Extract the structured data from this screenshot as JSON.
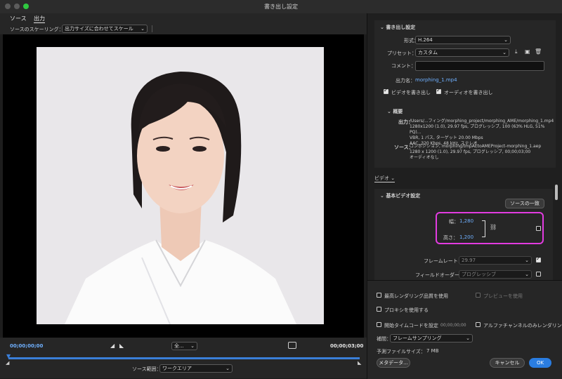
{
  "window": {
    "title": "書き出し設定"
  },
  "tabs": [
    {
      "label": "ソース"
    },
    {
      "label": "出力"
    }
  ],
  "scaling": {
    "label": "ソースのスケーリング：",
    "value": "出力サイズに合わせてスケール"
  },
  "timeline": {
    "start_timecode": "00;00;00;00",
    "end_timecode": "00;00;03;00",
    "zoom_value": "全...",
    "source_range_label": "ソース範囲：",
    "source_range_value": "ワークエリア"
  },
  "export_settings": {
    "header": "書き出し設定",
    "format_label": "形式：",
    "format_value": "H.264",
    "preset_label": "プリセット：",
    "preset_value": "カスタム",
    "comment_label": "コメント：",
    "comment_value": "",
    "output_name_label": "出力名：",
    "output_name_value": "morphing_1.mp4",
    "export_video_label": "ビデオを書き出し",
    "export_audio_label": "オーディオを書き出し",
    "export_video_checked": true,
    "export_audio_checked": true
  },
  "summary": {
    "header": "概要",
    "output_label": "出力：",
    "output_lines": [
      "/Users/...フィング/morphing_project/morphing_AME/morphing_1.mp4",
      "1280x1200 (1.0), 29.97 fps, プログレッシブ, 100 (63% HLG, 51% PQ)...",
      "VBR, 1 パス, ターゲット 20.00 Mbps",
      "AAC, 320 Kbps, 48 kHz, ステレオ"
    ],
    "source_label": "ソース：",
    "source_lines": [
      "コンポジション, morphing/tmpAEtoAMEProject-morphing_1.aep",
      "1280 x 1200 (1.0), 29.97 fps, プログレッシブ, 00;00;03;00",
      "オーディオなし"
    ]
  },
  "video_tab": {
    "label": "ビデオ"
  },
  "basic_video": {
    "header": "基本ビデオ設定",
    "match_source_button": "ソースの一致",
    "width_label": "幅：",
    "width_value": "1,280",
    "height_label": "高さ：",
    "height_value": "1,200",
    "frame_rate_label": "フレームレート：",
    "frame_rate_value": "29.97",
    "field_order_label": "フィールドオーダー：",
    "field_order_value": "プログレッシブ",
    "highlight_color": "#e23be0"
  },
  "bottom": {
    "max_render_quality": "最高レンダリング品質を使用",
    "use_previews": "プレビューを使用",
    "use_proxies": "プロキシを使用する",
    "set_start_timecode": "開始タイムコードを設定",
    "start_timecode_value": "00;00;00;00",
    "alpha_only": "アルファチャンネルのみレンダリング",
    "interpolation_label": "補間：",
    "interpolation_value": "フレームサンプリング",
    "estimated_size_label": "予測ファイルサイズ：",
    "estimated_size_value": "7 MB",
    "metadata_button": "メタデータ...",
    "cancel_button": "キャンセル",
    "ok_button": "OK"
  },
  "colors": {
    "accent": "#2a7de1",
    "timecode": "#6fb0ff",
    "link": "#6fb0ff"
  }
}
